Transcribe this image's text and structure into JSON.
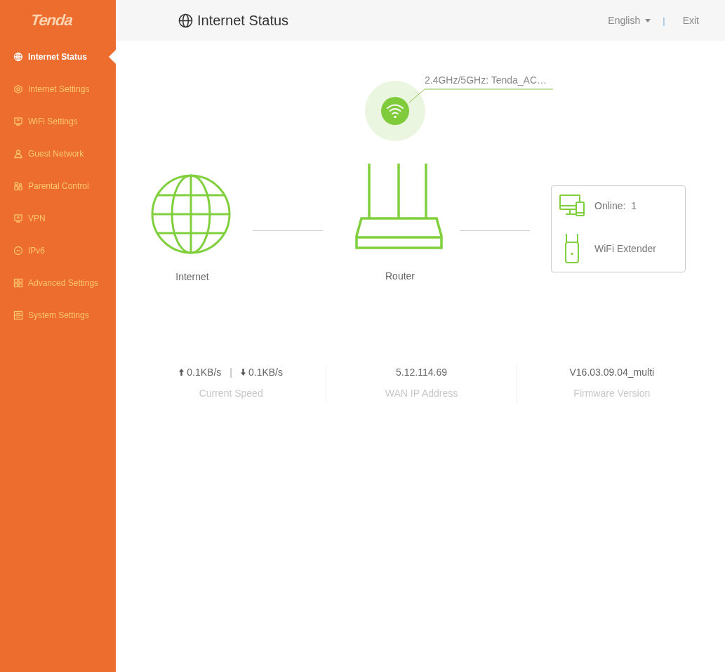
{
  "logo": "Tenda",
  "sidebar": {
    "items": [
      {
        "label": "Internet Status",
        "selected": true
      },
      {
        "label": "Internet Settings",
        "selected": false
      },
      {
        "label": "WiFi Settings",
        "selected": false
      },
      {
        "label": "Guest Network",
        "selected": false
      },
      {
        "label": "Parental Control",
        "selected": false
      },
      {
        "label": "VPN",
        "selected": false
      },
      {
        "label": "IPv6",
        "selected": false
      },
      {
        "label": "Advanced Settings",
        "selected": false
      },
      {
        "label": "System Settings",
        "selected": false
      }
    ]
  },
  "header": {
    "title": "Internet Status",
    "language": "English",
    "separator": "|",
    "exit": "Exit"
  },
  "diagram": {
    "wifi_label": "2.4GHz/5GHz: Tenda_AC…",
    "internet_label": "Internet",
    "router_label": "Router",
    "online_label": "Online:",
    "online_count": "1",
    "extender_label": "WiFi Extender"
  },
  "stats": {
    "upload": "0.1KB/s",
    "speed_separator": "|",
    "download": "0.1KB/s",
    "speed_label": "Current Speed",
    "wan_ip": "5.12.114.69",
    "wan_label": "WAN IP Address",
    "firmware": "V16.03.09.04_multi",
    "firmware_label": "Firmware Version"
  }
}
